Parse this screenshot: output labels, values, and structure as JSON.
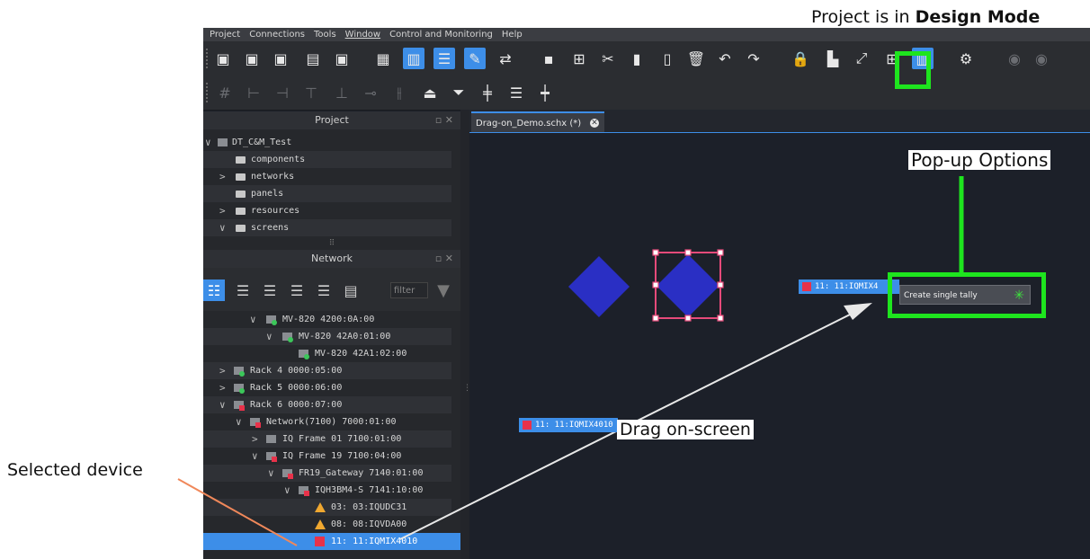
{
  "menu": [
    "Project",
    "Connections",
    "Tools",
    "Window",
    "Control and Monitoring",
    "Help"
  ],
  "toolbar_icons": [
    "new-schematic-icon",
    "new-panel-icon",
    "new-resource-icon",
    "save-icon",
    "save-as-icon",
    "copy-project-icon",
    "design-mode-icon",
    "tree-icon",
    "edit-icon",
    "swap-icon",
    "grid-small-icon",
    "grid-large-icon",
    "scissors-icon",
    "document-icon",
    "clipboard-icon",
    "trash-icon",
    "undo-icon",
    "redo-icon",
    "lock-icon",
    "layer-icon",
    "expand-icon",
    "table-icon",
    "design-mode-toggle-icon",
    "gear-icon"
  ],
  "project_panel": {
    "title": "Project",
    "root": "DT_C&M_Test",
    "items": [
      "components",
      "networks",
      "panels",
      "resources",
      "screens"
    ]
  },
  "network_panel": {
    "title": "Network",
    "filter_placeholder": "filter",
    "items": [
      "MV-820 4200:0A:00",
      "MV-820 42A0:01:00",
      "MV-820 42A1:02:00",
      "Rack 4 0000:05:00",
      "Rack 5 0000:06:00",
      "Rack 6 0000:07:00",
      "Network(7100) 7000:01:00",
      "IQ Frame 01 7100:01:00",
      "IQ Frame 19 7100:04:00",
      "FR19_Gateway 7140:01:00",
      "IQH3BM4-S 7141:10:00",
      "03: 03:IQUDC31",
      "08: 08:IQVDA00",
      "11: 11:IQMIX4010"
    ]
  },
  "editor_tab": "Drag-on_Demo.schx (*)",
  "canvas": {
    "tally_drag_label": "11: 11:IQMIX4010",
    "tally_top_label": "11: 11:IQMIX4",
    "popup_option": "Create single tally"
  },
  "annotations": {
    "design_mode_prefix": "Project is in ",
    "design_mode_bold": "Design Mode",
    "popup_options": "Pop-up Options",
    "drag_on_screen": "Drag on-screen",
    "selected_device": "Selected device"
  },
  "colors": {
    "highlight": "#3d8ee8",
    "callout_green": "#1ee51e",
    "diamond": "#2a2fc4",
    "alarm_red": "#e8324a",
    "warning_amber": "#f0a830"
  }
}
